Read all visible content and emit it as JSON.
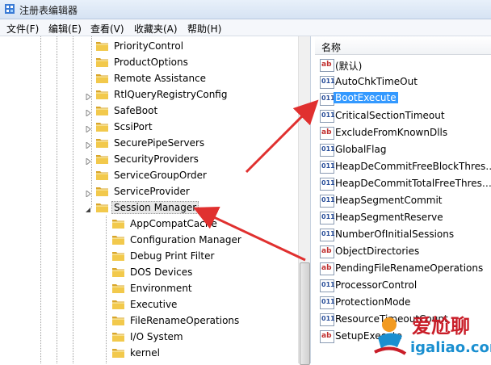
{
  "window": {
    "title": "注册表编辑器"
  },
  "menu": [
    "文件(F)",
    "编辑(E)",
    "查看(V)",
    "收藏夹(A)",
    "帮助(H)"
  ],
  "tree": {
    "items": [
      {
        "label": "PriorityControl",
        "level": 0,
        "expandable": false
      },
      {
        "label": "ProductOptions",
        "level": 0,
        "expandable": false
      },
      {
        "label": "Remote Assistance",
        "level": 0,
        "expandable": false
      },
      {
        "label": "RtlQueryRegistryConfig",
        "level": 0,
        "expandable": true
      },
      {
        "label": "SafeBoot",
        "level": 0,
        "expandable": true
      },
      {
        "label": "ScsiPort",
        "level": 0,
        "expandable": true
      },
      {
        "label": "SecurePipeServers",
        "level": 0,
        "expandable": true
      },
      {
        "label": "SecurityProviders",
        "level": 0,
        "expandable": true
      },
      {
        "label": "ServiceGroupOrder",
        "level": 0,
        "expandable": false
      },
      {
        "label": "ServiceProvider",
        "level": 0,
        "expandable": true
      },
      {
        "label": "Session Manager",
        "level": 0,
        "expandable": true,
        "expanded": true,
        "selected": true
      },
      {
        "label": "AppCompatCache",
        "level": 1,
        "expandable": false
      },
      {
        "label": "Configuration Manager",
        "level": 1,
        "expandable": false
      },
      {
        "label": "Debug Print Filter",
        "level": 1,
        "expandable": false
      },
      {
        "label": "DOS Devices",
        "level": 1,
        "expandable": false
      },
      {
        "label": "Environment",
        "level": 1,
        "expandable": false
      },
      {
        "label": "Executive",
        "level": 1,
        "expandable": false
      },
      {
        "label": "FileRenameOperations",
        "level": 1,
        "expandable": false
      },
      {
        "label": "I/O System",
        "level": 1,
        "expandable": false
      },
      {
        "label": "kernel",
        "level": 1,
        "expandable": false
      }
    ]
  },
  "values": {
    "column_name": "名称",
    "items": [
      {
        "name": "(默认)",
        "type": "sz"
      },
      {
        "name": "AutoChkTimeOut",
        "type": "dword"
      },
      {
        "name": "BootExecute",
        "type": "dword",
        "selected": true
      },
      {
        "name": "CriticalSectionTimeout",
        "type": "dword"
      },
      {
        "name": "ExcludeFromKnownDlls",
        "type": "sz"
      },
      {
        "name": "GlobalFlag",
        "type": "dword"
      },
      {
        "name": "HeapDeCommitFreeBlockThres…",
        "type": "dword"
      },
      {
        "name": "HeapDeCommitTotalFreeThres…",
        "type": "dword"
      },
      {
        "name": "HeapSegmentCommit",
        "type": "dword"
      },
      {
        "name": "HeapSegmentReserve",
        "type": "dword"
      },
      {
        "name": "NumberOfInitialSessions",
        "type": "dword"
      },
      {
        "name": "ObjectDirectories",
        "type": "sz"
      },
      {
        "name": "PendingFileRenameOperations",
        "type": "sz"
      },
      {
        "name": "ProcessorControl",
        "type": "dword"
      },
      {
        "name": "ProtectionMode",
        "type": "dword"
      },
      {
        "name": "ResourceTimeoutCount",
        "type": "dword"
      },
      {
        "name": "SetupExecute",
        "type": "sz"
      }
    ]
  },
  "icons": {
    "sz": "ab",
    "dword": "011"
  },
  "watermark": {
    "title": "爱尬聊",
    "url": "igaliao.com"
  },
  "colors": {
    "selection": "#3399ff",
    "arrow": "#e0302f",
    "folder": "#e8b83a"
  }
}
